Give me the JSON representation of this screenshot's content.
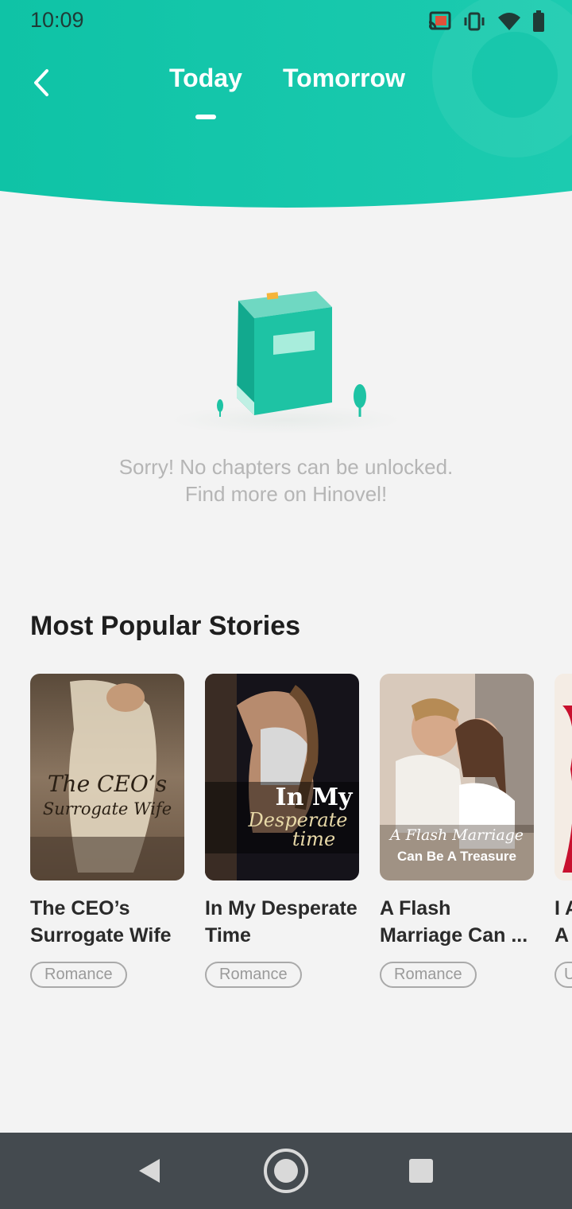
{
  "status_bar": {
    "time": "10:09",
    "icons": [
      "cast-icon",
      "vibrate-icon",
      "wifi-icon",
      "battery-icon"
    ]
  },
  "header": {
    "back_icon": "chevron-left-icon",
    "tabs": [
      {
        "label": "Today",
        "active": true
      },
      {
        "label": "Tomorrow",
        "active": false
      }
    ],
    "color": "#14c3a5"
  },
  "empty_state": {
    "icon": "book-illustration",
    "line1": "Sorry! No chapters can be unlocked.",
    "line2": "Find more on Hinovel!"
  },
  "popular": {
    "title": "Most Popular Stories",
    "books": [
      {
        "title_line1": "The CEO’s",
        "title_line2": "Surrogate Wife",
        "tag": "Romance",
        "cover_text_1": "The CEO’s",
        "cover_text_2": "Surrogate Wife"
      },
      {
        "title_line1": "In My Desperate",
        "title_line2": "Time",
        "tag": "Romance",
        "cover_text_1": "In My",
        "cover_text_2": "Desperate",
        "cover_text_3": "time"
      },
      {
        "title_line1": "A Flash",
        "title_line2": "Marriage Can ...",
        "tag": "Romance",
        "cover_text_1": "A Flash Marriage",
        "cover_text_2": "Can Be A Treasure"
      },
      {
        "title_line1": "I A",
        "title_line2": "A",
        "tag": "U"
      }
    ]
  },
  "nav_bar": {
    "buttons": [
      "back-triangle-icon",
      "home-circle-icon",
      "recents-square-icon"
    ]
  }
}
